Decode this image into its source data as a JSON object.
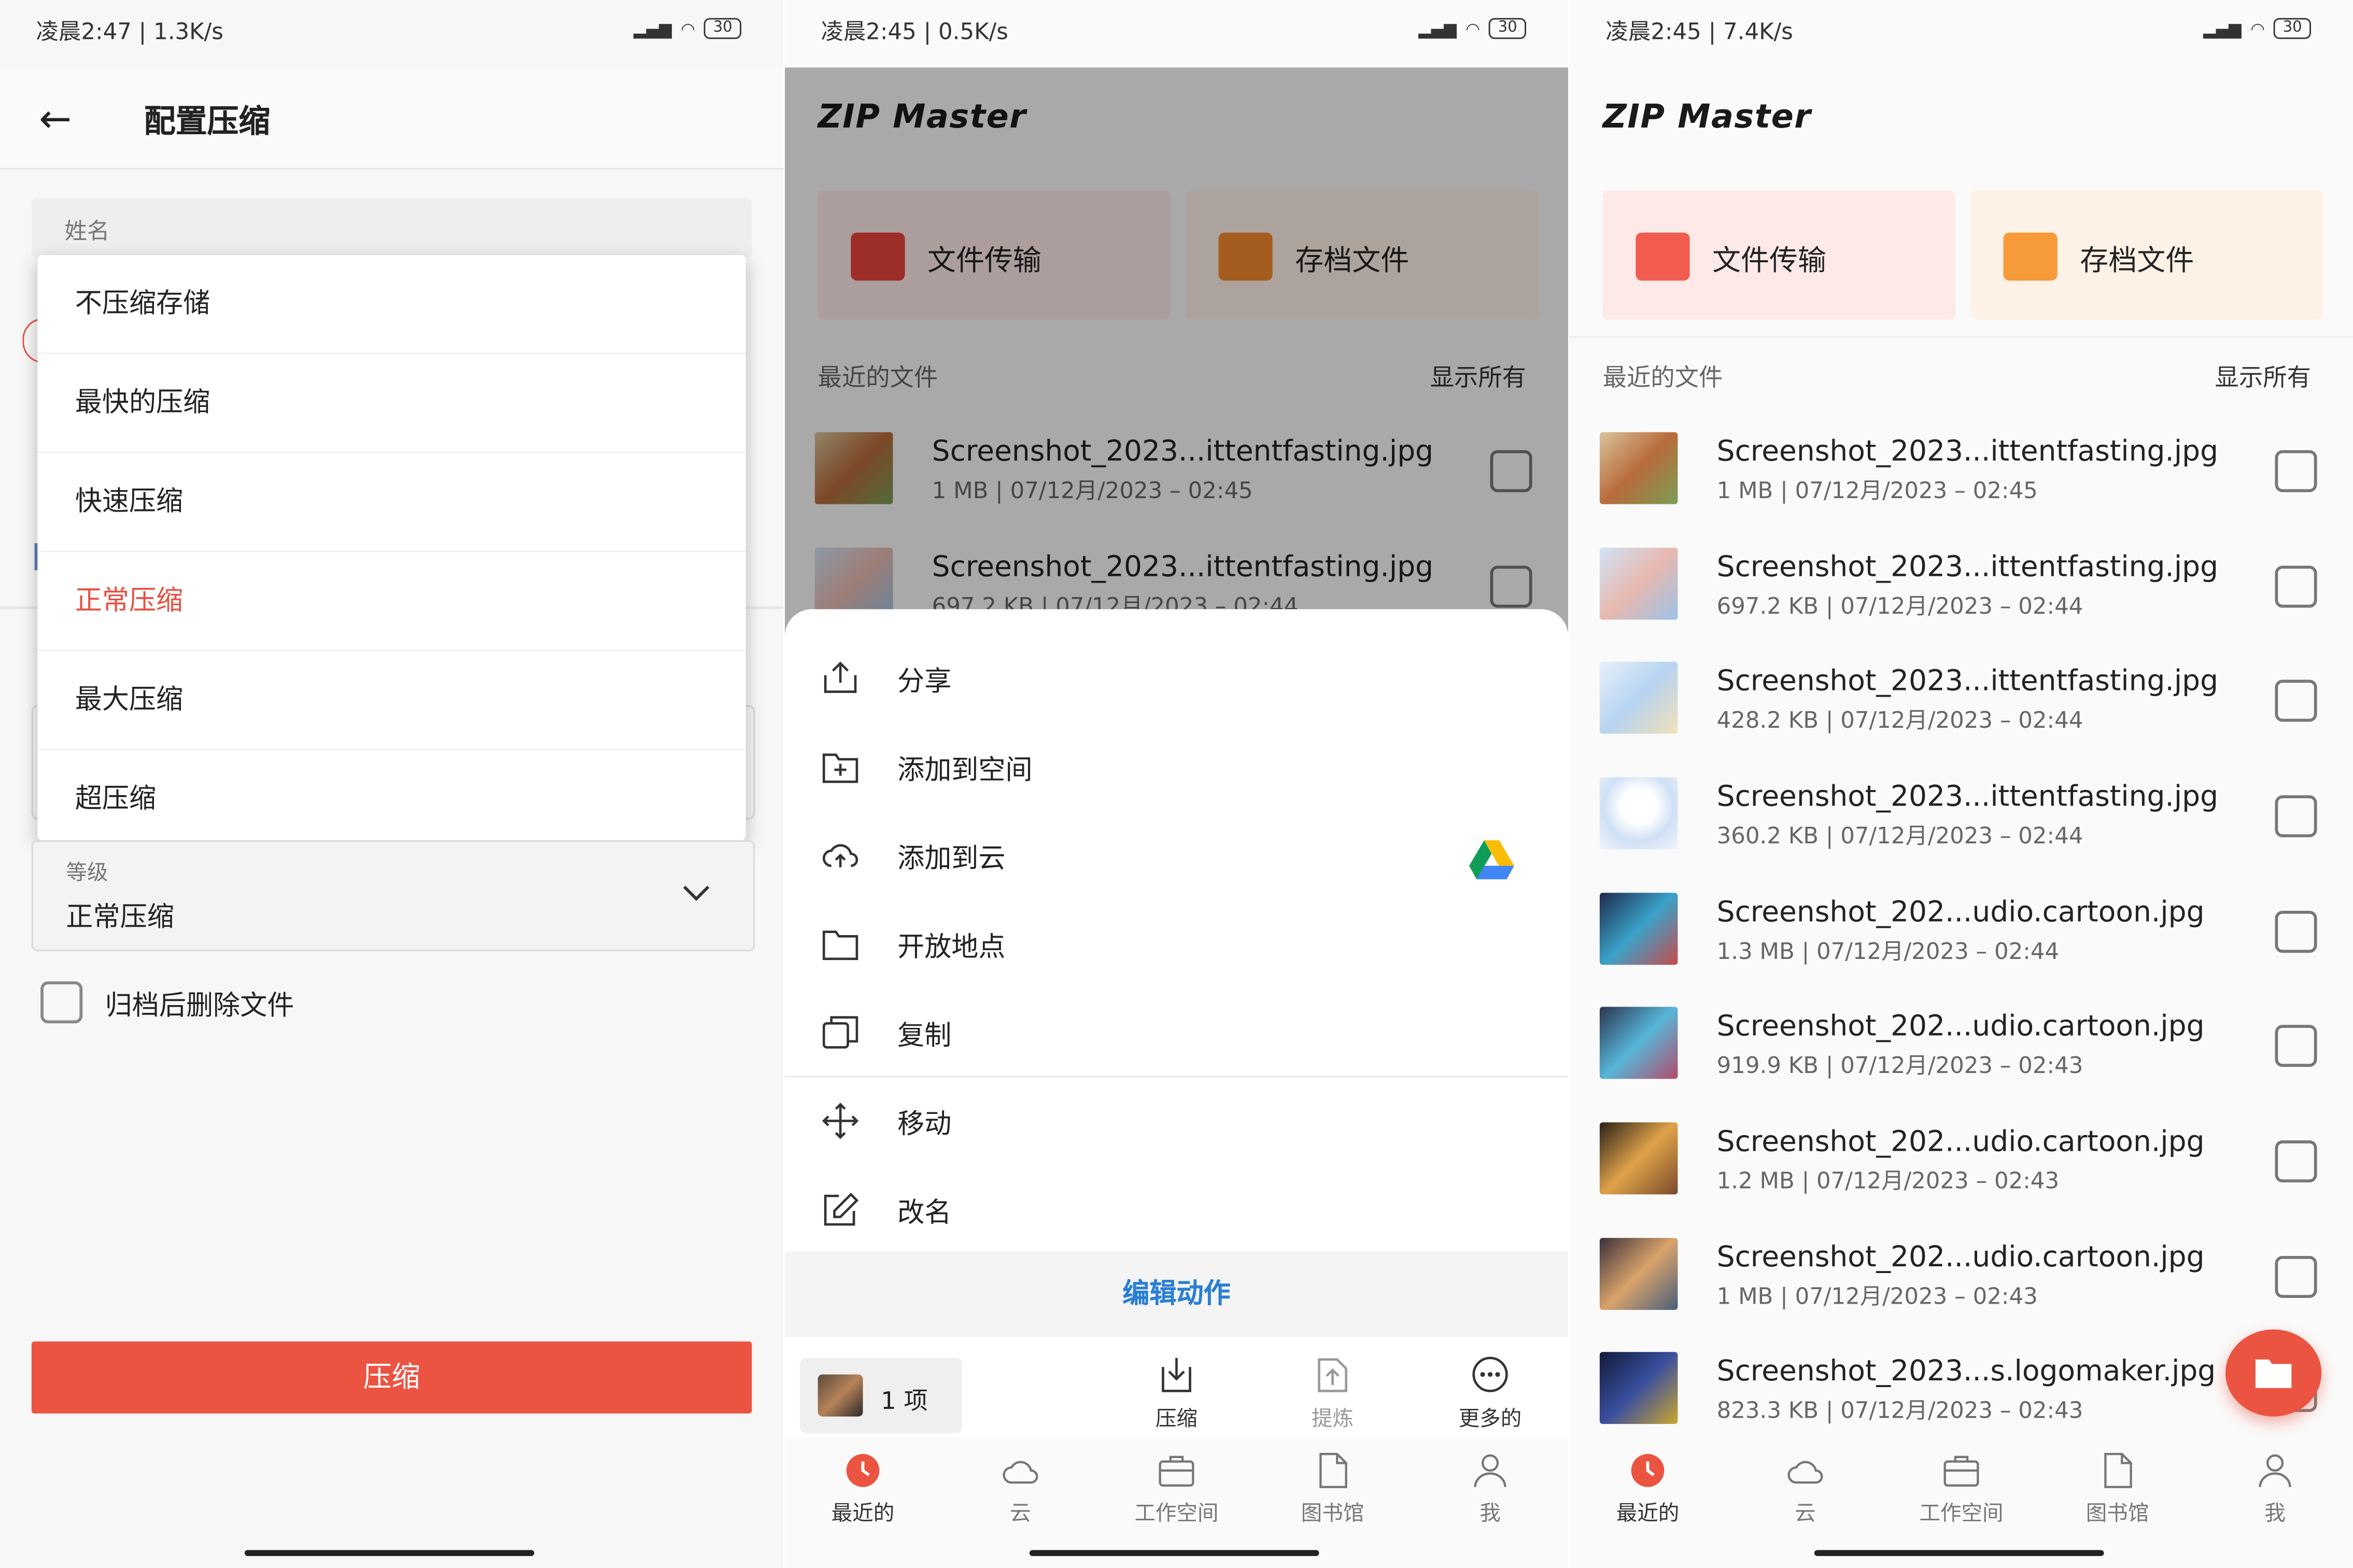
{
  "colors": {
    "accent": "#ec5442",
    "link_blue": "#2a7fd4",
    "card_red_bg": "#fde9e7",
    "card_orange_bg": "#fef1e6",
    "selected_red": "#e85040"
  },
  "panel1": {
    "status": {
      "time": "凌晨2:47 | 1.3K/s",
      "battery": "30"
    },
    "title": "配置压缩",
    "name_label": "姓名",
    "compression_options": [
      {
        "label": "不压缩存储",
        "selected": false
      },
      {
        "label": "最快的压缩",
        "selected": false
      },
      {
        "label": "快速压缩",
        "selected": false
      },
      {
        "label": "正常压缩",
        "selected": true
      },
      {
        "label": "最大压缩",
        "selected": false
      },
      {
        "label": "超压缩",
        "selected": false
      }
    ],
    "level_label": "等级",
    "level_value": "正常压缩",
    "delete_after_archive": "归档后删除文件",
    "compress_button": "压缩"
  },
  "panel2": {
    "status": {
      "time": "凌晨2:45 | 0.5K/s",
      "battery": "30"
    },
    "logo": "ZIP Master",
    "cards": [
      {
        "label": "文件传输"
      },
      {
        "label": "存档文件"
      }
    ],
    "recent_label": "最近的文件",
    "show_all": "显示所有",
    "files": [
      {
        "name": "Screenshot_2023...ittentfasting.jpg",
        "meta": "1 MB  |  07/12月/2023 – 02:45"
      },
      {
        "name": "Screenshot_2023...ittentfasting.jpg",
        "meta": "697.2 KB  |  07/12月/2023 – 02:44"
      }
    ],
    "sheet_items": [
      {
        "label": "分享",
        "icon": "share-icon"
      },
      {
        "label": "添加到空间",
        "icon": "add-folder-icon"
      },
      {
        "label": "添加到云",
        "icon": "cloud-upload-icon"
      },
      {
        "label": "开放地点",
        "icon": "folder-icon"
      },
      {
        "label": "复制",
        "icon": "copy-icon"
      },
      {
        "label": "移动",
        "icon": "move-icon"
      },
      {
        "label": "改名",
        "icon": "rename-icon"
      }
    ],
    "edit_action": "编辑动作",
    "selection_count": "1 项",
    "actions": [
      {
        "label": "压缩"
      },
      {
        "label": "提炼"
      },
      {
        "label": "更多的"
      }
    ]
  },
  "panel3": {
    "status": {
      "time": "凌晨2:45 | 7.4K/s",
      "battery": "30"
    },
    "logo": "ZIP Master",
    "cards": [
      {
        "label": "文件传输"
      },
      {
        "label": "存档文件"
      }
    ],
    "recent_label": "最近的文件",
    "show_all": "显示所有",
    "files": [
      {
        "name": "Screenshot_2023...ittentfasting.jpg",
        "meta": "1 MB  |  07/12月/2023 – 02:45"
      },
      {
        "name": "Screenshot_2023...ittentfasting.jpg",
        "meta": "697.2 KB  |  07/12月/2023 – 02:44"
      },
      {
        "name": "Screenshot_2023...ittentfasting.jpg",
        "meta": "428.2 KB  |  07/12月/2023 – 02:44"
      },
      {
        "name": "Screenshot_2023...ittentfasting.jpg",
        "meta": "360.2 KB  |  07/12月/2023 – 02:44"
      },
      {
        "name": "Screenshot_202...udio.cartoon.jpg",
        "meta": "1.3 MB  |  07/12月/2023 – 02:44"
      },
      {
        "name": "Screenshot_202...udio.cartoon.jpg",
        "meta": "919.9 KB  |  07/12月/2023 – 02:43"
      },
      {
        "name": "Screenshot_202...udio.cartoon.jpg",
        "meta": "1.2 MB  |  07/12月/2023 – 02:43"
      },
      {
        "name": "Screenshot_202...udio.cartoon.jpg",
        "meta": "1 MB  |  07/12月/2023 – 02:43"
      },
      {
        "name": "Screenshot_2023...s.logomaker.jpg",
        "meta": "823.3 KB  |  07/12月/2023 – 02:43"
      }
    ]
  },
  "nav": [
    {
      "label": "最近的",
      "icon": "clock-icon"
    },
    {
      "label": "云",
      "icon": "cloud-icon"
    },
    {
      "label": "工作空间",
      "icon": "briefcase-icon"
    },
    {
      "label": "图书馆",
      "icon": "document-icon"
    },
    {
      "label": "我",
      "icon": "person-icon"
    }
  ]
}
